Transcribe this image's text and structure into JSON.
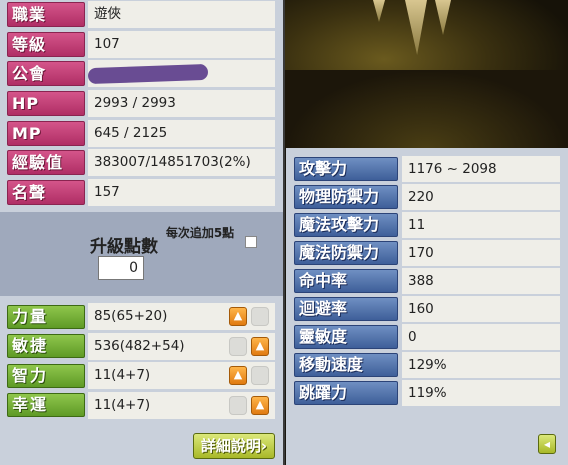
{
  "info": [
    {
      "label": "職業",
      "value": "遊俠"
    },
    {
      "label": "等級",
      "value": "107"
    },
    {
      "label": "公會",
      "value": ""
    },
    {
      "label": "HP",
      "value": "2993 / 2993"
    },
    {
      "label": "MP",
      "value": "645 / 2125"
    },
    {
      "label": "經驗值",
      "value": "383007/14851703(2%)"
    },
    {
      "label": "名聲",
      "value": "157"
    }
  ],
  "ap": {
    "label": "升級點數",
    "value": "0",
    "auto_label": "每次追加5點"
  },
  "stats": [
    {
      "label": "力量",
      "value": "85(65+20)"
    },
    {
      "label": "敏捷",
      "value": "536(482+54)"
    },
    {
      "label": "智力",
      "value": "11(4+7)"
    },
    {
      "label": "幸運",
      "value": "11(4+7)"
    }
  ],
  "detail_button": "詳細說明",
  "details": [
    {
      "label": "攻擊力",
      "value": "1176 ~ 2098"
    },
    {
      "label": "物理防禦力",
      "value": "220"
    },
    {
      "label": "魔法攻擊力",
      "value": "11"
    },
    {
      "label": "魔法防禦力",
      "value": "170"
    },
    {
      "label": "命中率",
      "value": "388"
    },
    {
      "label": "迴避率",
      "value": "160"
    },
    {
      "label": "靈敏度",
      "value": "0"
    },
    {
      "label": "移動速度",
      "value": "129%"
    },
    {
      "label": "跳躍力",
      "value": "119%"
    }
  ],
  "icons": {
    "up": "arrow-up-icon",
    "back": "arrow-left-icon"
  }
}
